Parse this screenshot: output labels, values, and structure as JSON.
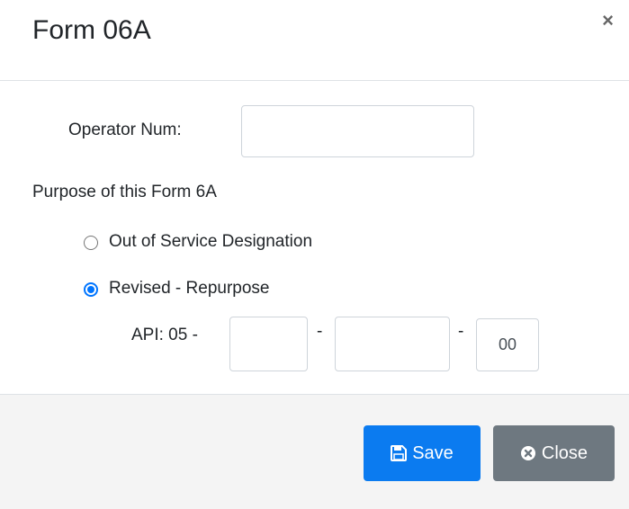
{
  "header": {
    "title": "Form 06A",
    "close_symbol": "×"
  },
  "form": {
    "operator_label": "Operator Num:",
    "operator_value": "",
    "purpose_label": "Purpose of this Form 6A",
    "purpose_options": [
      {
        "label": "Out of Service Designation",
        "checked": false
      },
      {
        "label": "Revised - Repurpose",
        "checked": true
      }
    ],
    "api": {
      "label": "API: 05 -",
      "separator": "-",
      "field1": "",
      "field2": "",
      "field3": "00"
    }
  },
  "footer": {
    "save_label": "Save",
    "close_label": "Close"
  },
  "colors": {
    "primary": "#0b7bf0",
    "secondary": "#6e7880",
    "radio_accent": "#0075ff"
  },
  "icons": {
    "save": "floppy-disk-icon",
    "close": "times-circle-icon",
    "header_close": "close-icon"
  }
}
